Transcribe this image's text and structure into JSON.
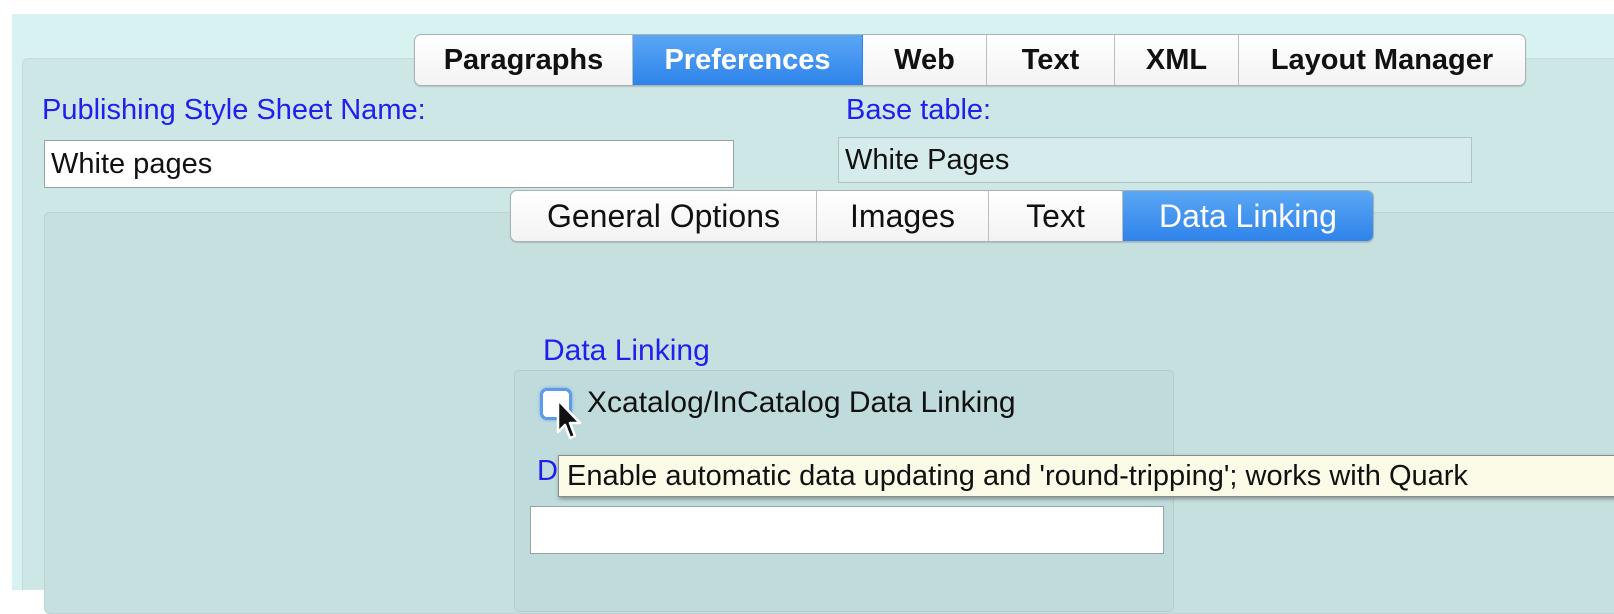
{
  "top_tabs": [
    {
      "label": "Paragraphs",
      "active": false
    },
    {
      "label": "Preferences",
      "active": true
    },
    {
      "label": "Web",
      "active": false
    },
    {
      "label": "Text",
      "active": false
    },
    {
      "label": "XML",
      "active": false
    },
    {
      "label": "Layout Manager",
      "active": false
    }
  ],
  "style_sheet": {
    "label": "Publishing Style Sheet Name:",
    "value": "White pages"
  },
  "base_table": {
    "label": "Base table:",
    "value": "White Pages"
  },
  "inner_tabs": [
    {
      "label": "General Options",
      "active": false
    },
    {
      "label": "Images",
      "active": false
    },
    {
      "label": "Text",
      "active": false
    },
    {
      "label": "Data Linking",
      "active": true
    }
  ],
  "data_linking": {
    "section_label": "Data Linking",
    "checkbox_label": "Xcatalog/InCatalog Data Linking",
    "checkbox_checked": false,
    "field_label_visible": "D",
    "field_value": ""
  },
  "tooltip": {
    "text": "Enable automatic data updating and 'round-tripping'; works with Quark"
  },
  "colors": {
    "accent": "#2f83ea",
    "label_blue": "#2020ee",
    "window_bg": "#d8f2f2"
  },
  "icons": {
    "cursor": "arrow-cursor-icon"
  }
}
